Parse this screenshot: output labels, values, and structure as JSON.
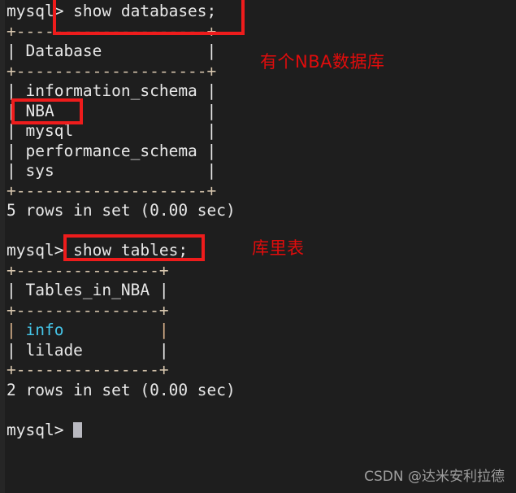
{
  "terminal": {
    "background_color": "#1e1e1e",
    "text_color": "#e8e8e8",
    "border_color": "#d7c6ae",
    "highlight_color": "#45c5e8",
    "lines": [
      {
        "id": "l01",
        "text": "mysql> show databases;"
      },
      {
        "id": "l02",
        "text": "+--------------------+"
      },
      {
        "id": "l03",
        "text": "| Database           |"
      },
      {
        "id": "l04",
        "text": "+--------------------+"
      },
      {
        "id": "l05",
        "text": "| information_schema |"
      },
      {
        "id": "l06",
        "text": "| NBA                |"
      },
      {
        "id": "l07",
        "text": "| mysql              |"
      },
      {
        "id": "l08",
        "text": "| performance_schema |"
      },
      {
        "id": "l09",
        "text": "| sys                |"
      },
      {
        "id": "l10",
        "text": "+--------------------+"
      },
      {
        "id": "l11",
        "text": "5 rows in set (0.00 sec)"
      },
      {
        "id": "l12",
        "text": ""
      },
      {
        "id": "l13",
        "text": "mysql> show tables;"
      },
      {
        "id": "l14",
        "text": "+---------------+"
      },
      {
        "id": "l15",
        "text": "| Tables_in_NBA |"
      },
      {
        "id": "l16",
        "text": "+---------------+"
      },
      {
        "id": "l17",
        "text": "| info          |"
      },
      {
        "id": "l18",
        "text": "| lilade        |"
      },
      {
        "id": "l19",
        "text": "+---------------+"
      },
      {
        "id": "l20",
        "text": "2 rows in set (0.00 sec)"
      },
      {
        "id": "l21",
        "text": ""
      },
      {
        "id": "l22",
        "text": "mysql> "
      }
    ],
    "prompt": "mysql>",
    "commands": [
      "show databases;",
      "show tables;"
    ],
    "databases": [
      "information_schema",
      "NBA",
      "mysql",
      "performance_schema",
      "sys"
    ],
    "databases_header": "Database",
    "databases_result": "5 rows in set (0.00 sec)",
    "tables_header": "Tables_in_NBA",
    "tables": [
      "info",
      "lilade"
    ],
    "tables_result": "2 rows in set (0.00 sec)"
  },
  "annotations": {
    "color": "#e00c0c",
    "database_note": "有个NBA数据库",
    "tables_note": "库里表",
    "boxes": [
      {
        "name": "show-databases-command",
        "label": "show databases;"
      },
      {
        "name": "nba-database-row",
        "label": "NBA"
      },
      {
        "name": "show-tables-command",
        "label": "show tables;"
      }
    ]
  },
  "watermark": {
    "text": "CSDN @达米安利拉德"
  }
}
